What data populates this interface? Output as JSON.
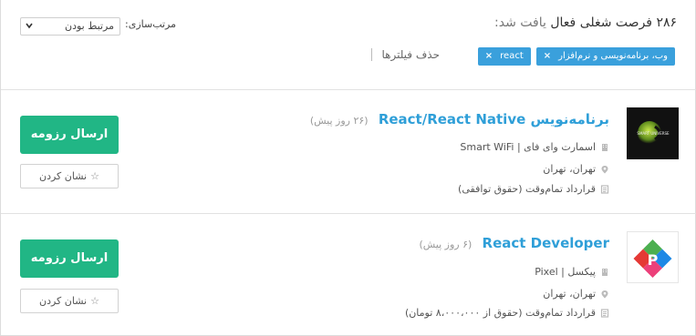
{
  "header": {
    "result_count": "۲۸۶",
    "result_text_a": "فرصت شغلی فعال",
    "result_text_b": "یافت شد:",
    "sort_label": "مرتب‌سازی:",
    "sort_value": "مرتبط بودن",
    "filters": [
      {
        "label": "react",
        "remove": "×"
      },
      {
        "label": "وب، برنامه‌نویسی و نرم‌افزار",
        "remove": "×"
      }
    ],
    "clear_filters": "حذف فیلترها"
  },
  "jobs": [
    {
      "title": "برنامه‌نویس React/React Native",
      "posted": "(۲۶ روز پیش)",
      "company": "اسمارت وای فای | Smart WiFi",
      "location": "تهران، تهران",
      "contract": "قرارداد تمام‌وقت (حقوق توافقی)",
      "logo_text": "SMART UNIVERSE",
      "apply_label": "ارسال رزومه",
      "bookmark_label": "نشان کردن"
    },
    {
      "title": "React Developer",
      "posted": "(۶ روز پیش)",
      "company": "پیکسل | Pixel",
      "location": "تهران، تهران",
      "contract": "قرارداد تمام‌وقت (حقوق از ۸،۰۰۰،۰۰۰ تومان)",
      "logo_text": "P",
      "apply_label": "ارسال رزومه",
      "bookmark_label": "نشان کردن"
    }
  ],
  "colors": {
    "accent_blue": "#2f9fd8",
    "chip_blue": "#3aa0dc",
    "apply_green": "#21b685"
  },
  "icons": [
    "chevron-down-icon",
    "close-icon",
    "building-icon",
    "location-pin-icon",
    "contract-icon",
    "star-icon"
  ]
}
